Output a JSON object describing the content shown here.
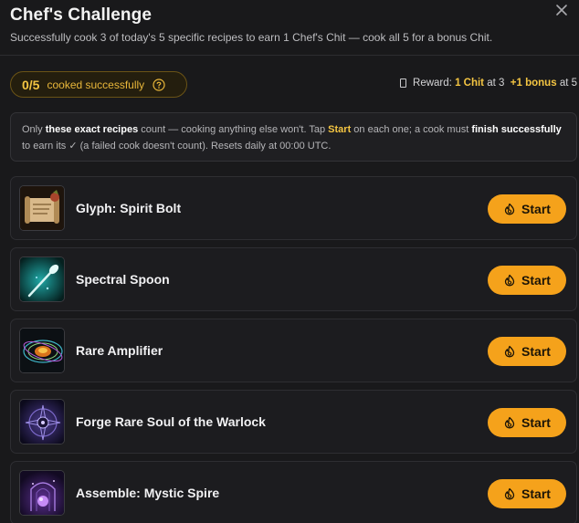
{
  "header": {
    "title": "Chef's Challenge",
    "subtitle": "Successfully cook 3 of today's 5 specific recipes to earn 1 Chef's Chit — cook all 5 for a bonus Chit."
  },
  "progress": {
    "count": "0/5",
    "label": "cooked successfully"
  },
  "reward": {
    "prefix": "Reward:",
    "chit": "1 Chit",
    "at3": "at 3",
    "bonus": "+1 bonus",
    "at5": "at 5"
  },
  "notice": {
    "p1": "Only ",
    "b1": "these exact recipes",
    "p2": " count — cooking anything else won't. Tap ",
    "start": "Start",
    "p3": " on each one; a cook must ",
    "b2": "finish successfully",
    "p4": " to earn its ✓ (a failed cook doesn't count). Resets daily at 00:00 UTC."
  },
  "recipes": [
    {
      "name": "Glyph: Spirit Bolt",
      "button": "Start",
      "icon": "scroll-icon"
    },
    {
      "name": "Spectral Spoon",
      "button": "Start",
      "icon": "spoon-icon"
    },
    {
      "name": "Rare Amplifier",
      "button": "Start",
      "icon": "amplifier-icon"
    },
    {
      "name": "Forge Rare Soul of the Warlock",
      "button": "Start",
      "icon": "warlock-soul-icon"
    },
    {
      "name": "Assemble: Mystic Spire",
      "button": "Start",
      "icon": "spire-icon"
    }
  ],
  "colors": {
    "accent": "#f5a21b",
    "gold": "#f4c542",
    "background": "#19191b"
  }
}
